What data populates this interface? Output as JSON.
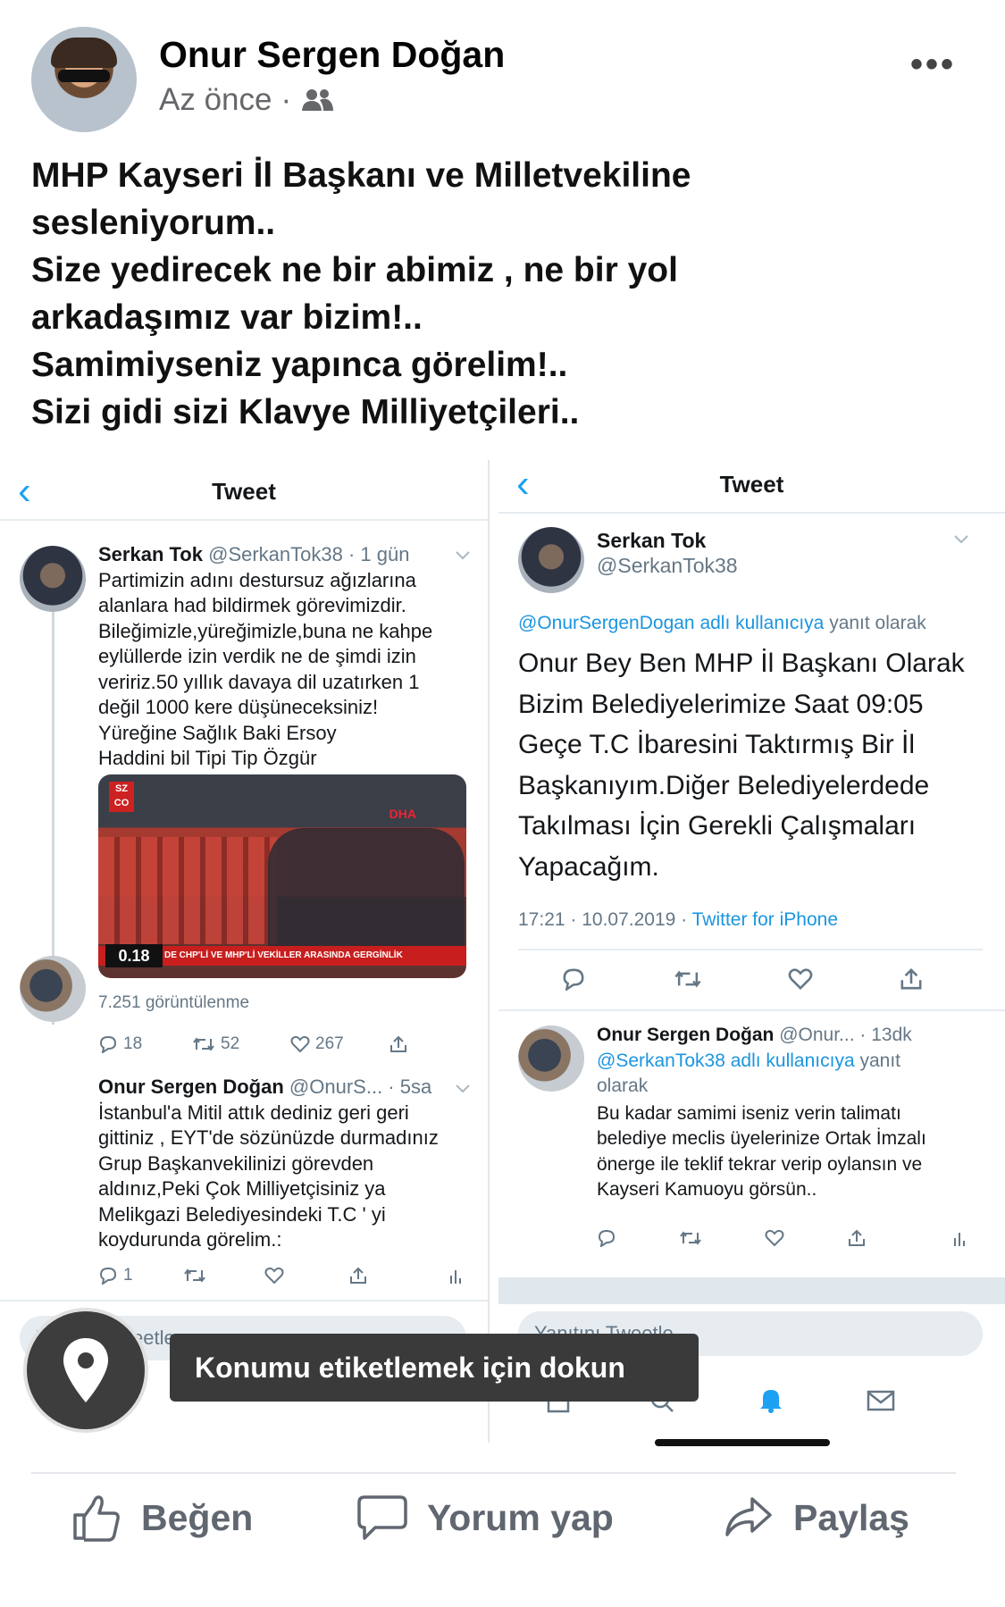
{
  "post": {
    "author": "Onur Sergen Doğan",
    "time": "Az önce",
    "separator": "·",
    "audience_icon": "friends-icon",
    "more_icon": "•••",
    "text_lines": [
      "MHP Kayseri İl Başkanı ve Milletvekiline",
      "sesleniyorum..",
      "Size yedirecek ne bir abimiz , ne bir yol",
      "arkadaşımız var bizim!..",
      "Samimiyseniz yapınca görelim!..",
      "Sizi gidi sizi Klavye Milliyetçileri.."
    ]
  },
  "left_shot": {
    "nav": {
      "back": "‹",
      "title": "Tweet"
    },
    "tweet1": {
      "name": "Serkan Tok",
      "handle": "@SerkanTok38 · 1 gün",
      "lines": [
        "Partimizin adını destursuz ağızlarına",
        "alanlara had bildirmek görevimizdir.",
        "Bileğimizle,yüreğimizle,buna ne kahpe",
        "eylüllerde izin verdik ne de şimdi izin",
        "veririz.50 yıllık davaya dil uzatırken 1",
        "değil 1000 kere düşüneceksiniz!",
        "Yüreğine Sağlık Baki Ersoy",
        "Haddini bil Tipi Tip Özgür"
      ],
      "media": {
        "logo": "SZ CO",
        "agency": "DHA",
        "ticker": "DE CHP'Lİ VE MHP'Lİ VEKİLLER ARASINDA GERGİNLİK",
        "time": "0.18"
      },
      "views": "7.251 görüntülenme",
      "replies": "18",
      "retweets": "52",
      "likes": "267"
    },
    "tweet2": {
      "name": "Onur Sergen Doğan",
      "handle": "@OnurS... · 5sa",
      "lines": [
        "İstanbul'a Mitil attık dediniz geri geri",
        "gittiniz , EYT'de sözünüzde durmadınız",
        "Grup Başkanvekilinizi görevden",
        "aldınız,Peki Çok Milliyetçisiniz ya",
        "Melikgazi Belediyesindeki T.C ' yi",
        "koydurunda görelim.:"
      ],
      "replies": "1"
    },
    "reply_placeholder": "Yanıtını Tweetle"
  },
  "right_shot": {
    "nav": {
      "back": "‹",
      "title": "Tweet"
    },
    "tweet1": {
      "name": "Serkan Tok",
      "handle": "@SerkanTok38",
      "reply_to_link": "@OnurSergenDogan adlı kullanıcıya",
      "reply_to_rest": " yanıt olarak",
      "lines": [
        "Onur Bey Ben MHP İl Başkanı Olarak",
        "Bizim Belediyelerimize Saat 09:05",
        "Geçe T.C İbaresini Taktırmış Bir İl",
        "Başkanıyım.Diğer Belediyelerdede",
        "Takılması İçin Gerekli Çalışmaları",
        "Yapacağım."
      ],
      "timestamp": "17:21 · 10.07.2019 · ",
      "client": "Twitter for iPhone"
    },
    "tweet2": {
      "name": "Onur Sergen Doğan",
      "handle": "@Onur... · 13dk",
      "reply_to_link": "@SerkanTok38 adlı kullanıcıya",
      "reply_to_rest": " yanıt",
      "reply_to_rest2": "olarak",
      "lines": [
        "Bu kadar samimi iseniz verin talimatı",
        "belediye meclis üyelerinize Ortak İmzalı",
        "önerge ile teklif tekrar verip oylansın ve",
        "Kayseri Kamuoyu görsün.."
      ]
    },
    "reply_placeholder": "Yanıtını Tweetle"
  },
  "location_toast": "Konumu etiketlemek için dokun",
  "actions": {
    "like": "Beğen",
    "comment": "Yorum yap",
    "share": "Paylaş"
  },
  "colors": {
    "twitter_blue": "#1da1f2",
    "fb_gray": "#606770"
  }
}
